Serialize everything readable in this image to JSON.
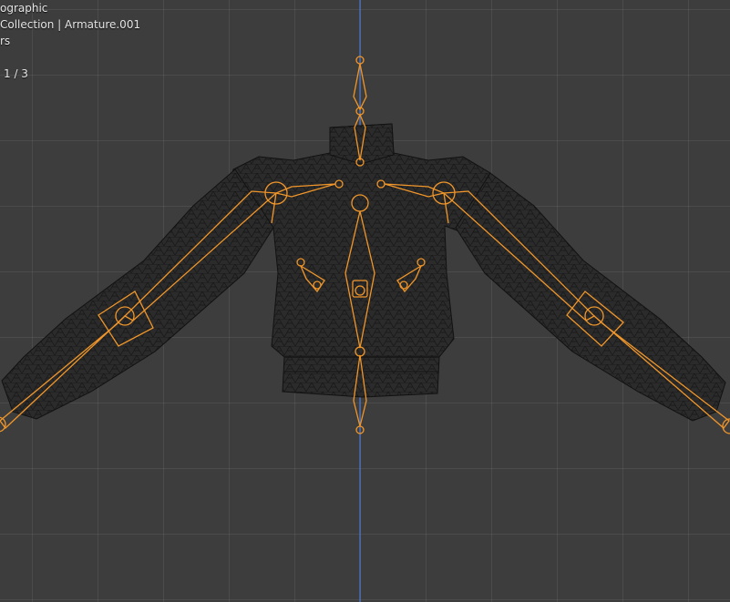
{
  "viewport": {
    "view_name": "ographic",
    "collection_line": "Collection | Armature.001",
    "third_line": "rs",
    "frame_counter": "1 / 3"
  },
  "colors": {
    "background": "#3d3d3d",
    "grid": "#4a4a4a",
    "axis": "#4a78d0",
    "mesh_fill": "#2a2a2a",
    "wire": "#121212",
    "bone": "#f0962a"
  },
  "scene": {
    "mesh_object": "garment-mesh",
    "armature_object": "armature-selected"
  }
}
